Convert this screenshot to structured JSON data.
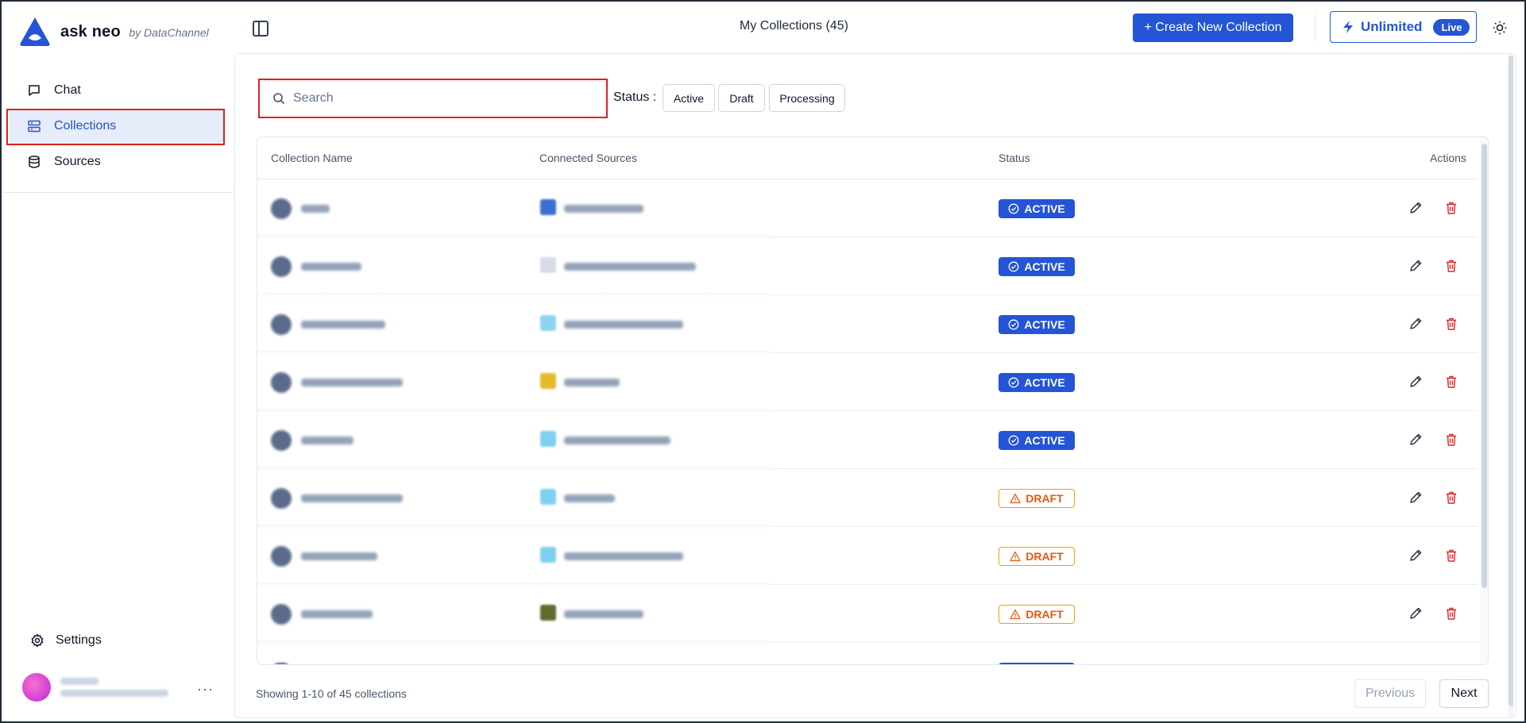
{
  "brand": {
    "name": "ask neo",
    "by": "by DataChannel",
    "accent": "#2455d6"
  },
  "sidebar": {
    "items": [
      {
        "label": "Chat",
        "icon": "chat-icon"
      },
      {
        "label": "Collections",
        "icon": "collections-icon",
        "active": true
      },
      {
        "label": "Sources",
        "icon": "database-icon"
      }
    ],
    "settings_label": "Settings",
    "more_label": "···"
  },
  "header": {
    "title": "My Collections (45)",
    "create_label": "+ Create New Collection",
    "plan_label": "Unlimited",
    "live_label": "Live"
  },
  "filters": {
    "search_placeholder": "Search",
    "status_label": "Status :",
    "chips": [
      "Active",
      "Draft",
      "Processing"
    ]
  },
  "table": {
    "columns": [
      "Collection Name",
      "Connected Sources",
      "Status",
      "Actions"
    ],
    "rows": [
      {
        "status": "ACTIVE",
        "source_color": "#3b6fd1"
      },
      {
        "status": "ACTIVE",
        "source_color": "#d6dde8"
      },
      {
        "status": "ACTIVE",
        "source_color": "#8fd3f2"
      },
      {
        "status": "ACTIVE",
        "source_color": "#e8b92c"
      },
      {
        "status": "ACTIVE",
        "source_color": "#7fd0f0"
      },
      {
        "status": "DRAFT",
        "source_color": "#7fd0f0"
      },
      {
        "status": "DRAFT",
        "source_color": "#7fd0f0"
      },
      {
        "status": "DRAFT",
        "source_color": "#5f6b2a"
      }
    ]
  },
  "footer": {
    "summary": "Showing 1-10 of 45 collections",
    "previous_label": "Previous",
    "next_label": "Next"
  }
}
